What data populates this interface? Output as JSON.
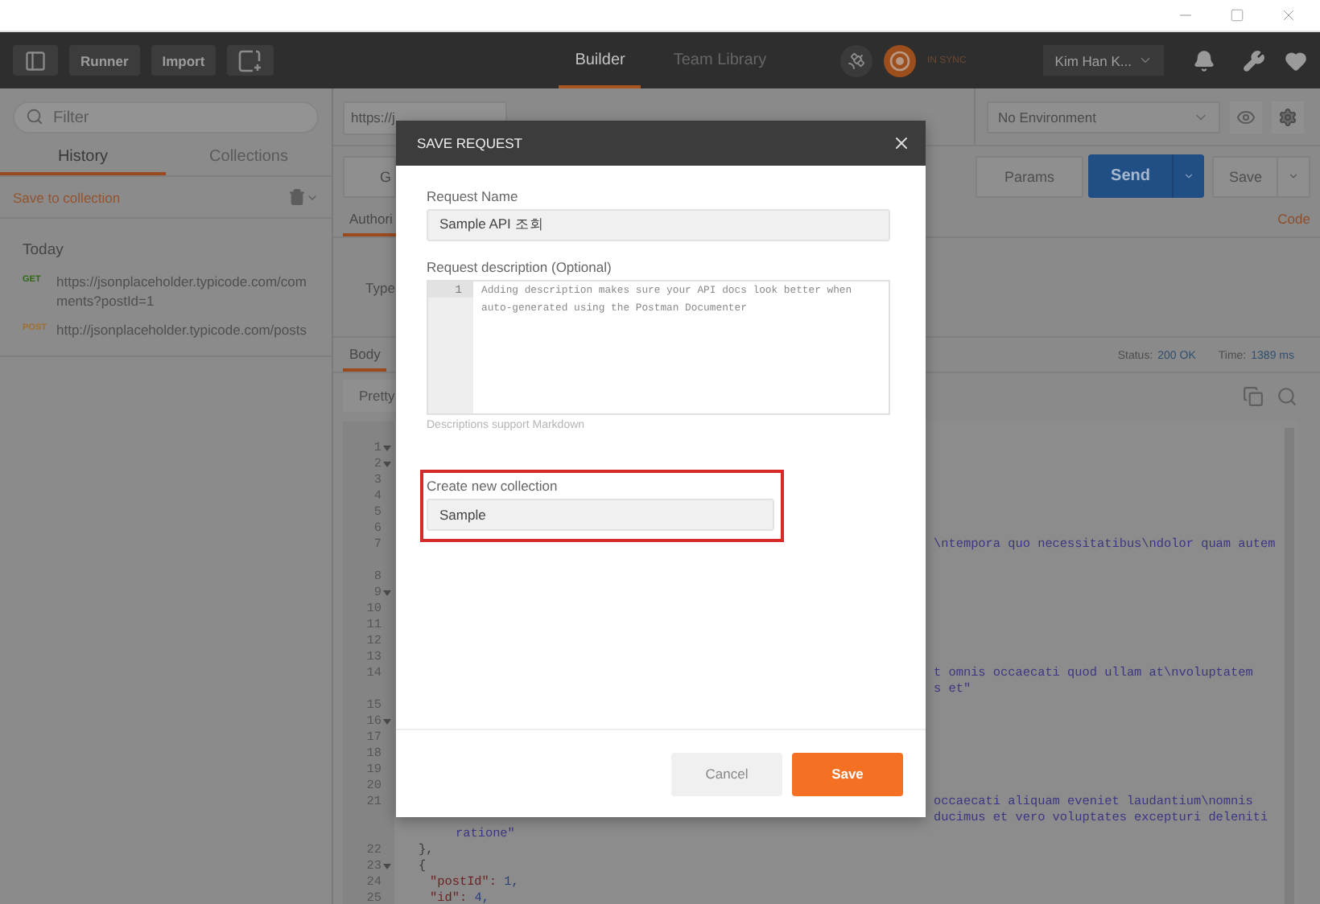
{
  "toolbar": {
    "buttons": [
      {
        "label": "Runner"
      },
      {
        "label": "Import"
      }
    ],
    "tabs": [
      {
        "label": "Builder",
        "selected": true
      },
      {
        "label": "Team Library",
        "selected": false
      }
    ],
    "sync_status": "IN SYNC",
    "user": "Kim Han K..."
  },
  "sidebar": {
    "search": {
      "placeholder": "Filter"
    },
    "tabs": [
      {
        "label": "History",
        "selected": true
      },
      {
        "label": "Collections",
        "selected": false
      }
    ],
    "save_link": "Save to collection",
    "groups": [
      {
        "title": "Today",
        "items": [
          {
            "method": "GET",
            "color": "#2f6a12",
            "url": "https://jsonplaceholder.typicode.com/comments?postId=1"
          },
          {
            "method": "POST",
            "color": "#a0702e",
            "url": "http://jsonplaceholder.typicode.com/posts"
          }
        ]
      }
    ]
  },
  "request": {
    "url": "https://j",
    "method": "G",
    "environment": "No Environment",
    "params": "Params",
    "send": "Send",
    "save": "Save",
    "tabs": [
      {
        "label": "Authori",
        "selected": true
      }
    ],
    "code_link": "Code",
    "type_label": "Type"
  },
  "response": {
    "tabs": [
      {
        "label": "Body",
        "selected": true
      }
    ],
    "status_label": "Status:",
    "status": "200 OK",
    "time_label": "Time:",
    "time": "1389 ms",
    "view": "Pretty",
    "lines": [
      {
        "number": "1",
        "fold": true,
        "kind": "hidden"
      },
      {
        "number": "2",
        "fold": true,
        "kind": "hidden"
      },
      {
        "number": "3",
        "fold": false,
        "kind": "hidden"
      },
      {
        "number": "4",
        "fold": false,
        "kind": "hidden"
      },
      {
        "number": "5",
        "fold": false,
        "kind": "hidden"
      },
      {
        "number": "6",
        "fold": false,
        "kind": "hidden"
      },
      {
        "number": "7",
        "fold": false,
        "kind": "tail",
        "text": "\\ntempora quo necessitatibus\\ndolor quam autem"
      },
      {
        "fold": false,
        "kind": "hidden"
      },
      {
        "number": "8",
        "fold": false,
        "kind": "hidden"
      },
      {
        "number": "9",
        "fold": true,
        "kind": "hidden"
      },
      {
        "number": "10",
        "fold": false,
        "kind": "hidden"
      },
      {
        "number": "11",
        "fold": false,
        "kind": "hidden"
      },
      {
        "number": "12",
        "fold": false,
        "kind": "hidden"
      },
      {
        "number": "13",
        "fold": false,
        "kind": "hidden"
      },
      {
        "number": "14",
        "fold": false,
        "kind": "tail",
        "text": "t omnis occaecati quod ullam at\\nvoluptatem"
      },
      {
        "fold": false,
        "kind": "tail",
        "text": "s et\""
      },
      {
        "number": "15",
        "fold": false,
        "kind": "hidden"
      },
      {
        "number": "16",
        "fold": true,
        "kind": "hidden"
      },
      {
        "number": "17",
        "fold": false,
        "kind": "hidden"
      },
      {
        "number": "18",
        "fold": false,
        "kind": "hidden"
      },
      {
        "number": "19",
        "fold": false,
        "kind": "hidden"
      },
      {
        "number": "20",
        "fold": false,
        "kind": "hidden"
      },
      {
        "number": "21",
        "fold": false,
        "kind": "tail",
        "text": "occaecati aliquam eveniet laudantium\\nomnis"
      },
      {
        "fold": false,
        "kind": "tail",
        "text": "ducimus et vero voluptates excepturi deleniti"
      },
      {
        "fold": false,
        "kind": "wrapped",
        "text": "ratione\""
      },
      {
        "number": "22",
        "fold": false,
        "kind": "punct",
        "text": "},"
      },
      {
        "number": "23",
        "fold": true,
        "kind": "punct",
        "text": "{"
      },
      {
        "number": "24",
        "fold": false,
        "kind": "pair",
        "key": "\"postId\":",
        "value": "1,"
      },
      {
        "number": "25",
        "fold": false,
        "kind": "pair",
        "key": "\"id\":",
        "value": "4,"
      }
    ]
  },
  "dialog": {
    "title": "SAVE REQUEST",
    "name_label": "Request Name",
    "name_value": "Sample API 조회",
    "description_label": "Request description (Optional)",
    "description_line_number": "1",
    "description_placeholder": "Adding description makes sure your API docs look better when auto-generated using the Postman Documenter",
    "description_hint": "Descriptions support Markdown",
    "collection_label": "Create new collection",
    "collection_value": "Sample",
    "buttons": [
      {
        "label": "Cancel",
        "kind": "secondary"
      },
      {
        "label": "Save",
        "kind": "primary"
      }
    ]
  }
}
